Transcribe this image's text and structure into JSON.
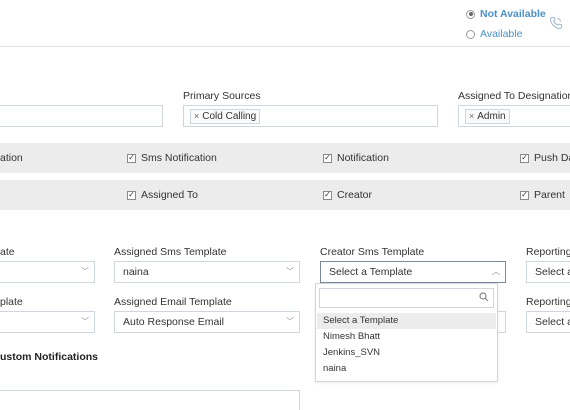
{
  "header": {
    "status_options": [
      {
        "label": "Not Available",
        "selected": true
      },
      {
        "label": "Available",
        "selected": false
      }
    ],
    "phone_icon": "phone-call-icon"
  },
  "filters": {
    "primary_sources": {
      "label": "Primary Sources",
      "tags": [
        "Cold Calling"
      ]
    },
    "assigned_to_designation": {
      "label": "Assigned To Designation",
      "tags": [
        "Admin"
      ]
    }
  },
  "notify_row1": [
    "ation",
    "Sms Notification",
    "Notification",
    "Push Da"
  ],
  "notify_row2": [
    "Assigned To",
    "Creator",
    "Parent"
  ],
  "templates": {
    "row1": {
      "partial_label": "ate",
      "assigned_sms": {
        "label": "Assigned Sms Template",
        "value": "naina"
      },
      "creator_sms": {
        "label": "Creator Sms Template",
        "value": "Select a Template"
      },
      "reporting": {
        "label": "Reporting",
        "value": "Select a"
      }
    },
    "row2": {
      "partial_label": "plate",
      "assigned_email": {
        "label": "Assigned Email Template",
        "value": "Auto Response Email"
      },
      "reporting": {
        "label": "Reporting",
        "value": "Select a"
      }
    }
  },
  "custom_notifications_title": "ustom Notifications",
  "dropdown": {
    "search_placeholder": "",
    "options": [
      "Select a Template",
      "Nimesh Bhatt",
      "Jenkins_SVN",
      "naina"
    ],
    "active_index": 0
  },
  "colors": {
    "accent": "#4a90c8",
    "band": "#ececec",
    "border": "#cfd6dd"
  }
}
